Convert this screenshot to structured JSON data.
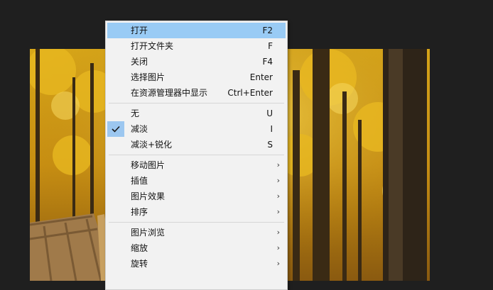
{
  "background_color": "#1f1f1f",
  "photo": {
    "subject": "autumn-forest-boardwalk"
  },
  "context_menu": {
    "highlight_color": "#99cbf5",
    "groups": [
      [
        {
          "label": "打开",
          "shortcut": "F2",
          "highlighted": true
        },
        {
          "label": "打开文件夹",
          "shortcut": "F"
        },
        {
          "label": "关闭",
          "shortcut": "F4"
        },
        {
          "label": "选择图片",
          "shortcut": "Enter"
        },
        {
          "label": "在资源管理器中显示",
          "shortcut": "Ctrl+Enter"
        }
      ],
      [
        {
          "label": "无",
          "shortcut": "U"
        },
        {
          "label": "减淡",
          "shortcut": "I",
          "checked": true
        },
        {
          "label": "减淡+锐化",
          "shortcut": "S"
        }
      ],
      [
        {
          "label": "移动图片",
          "submenu": true
        },
        {
          "label": "插值",
          "submenu": true
        },
        {
          "label": "图片效果",
          "submenu": true
        },
        {
          "label": "排序",
          "submenu": true
        }
      ],
      [
        {
          "label": "图片浏览",
          "submenu": true
        },
        {
          "label": "缩放",
          "submenu": true
        },
        {
          "label": "旋转",
          "submenu": true
        }
      ]
    ],
    "submenu_glyph": "›"
  }
}
